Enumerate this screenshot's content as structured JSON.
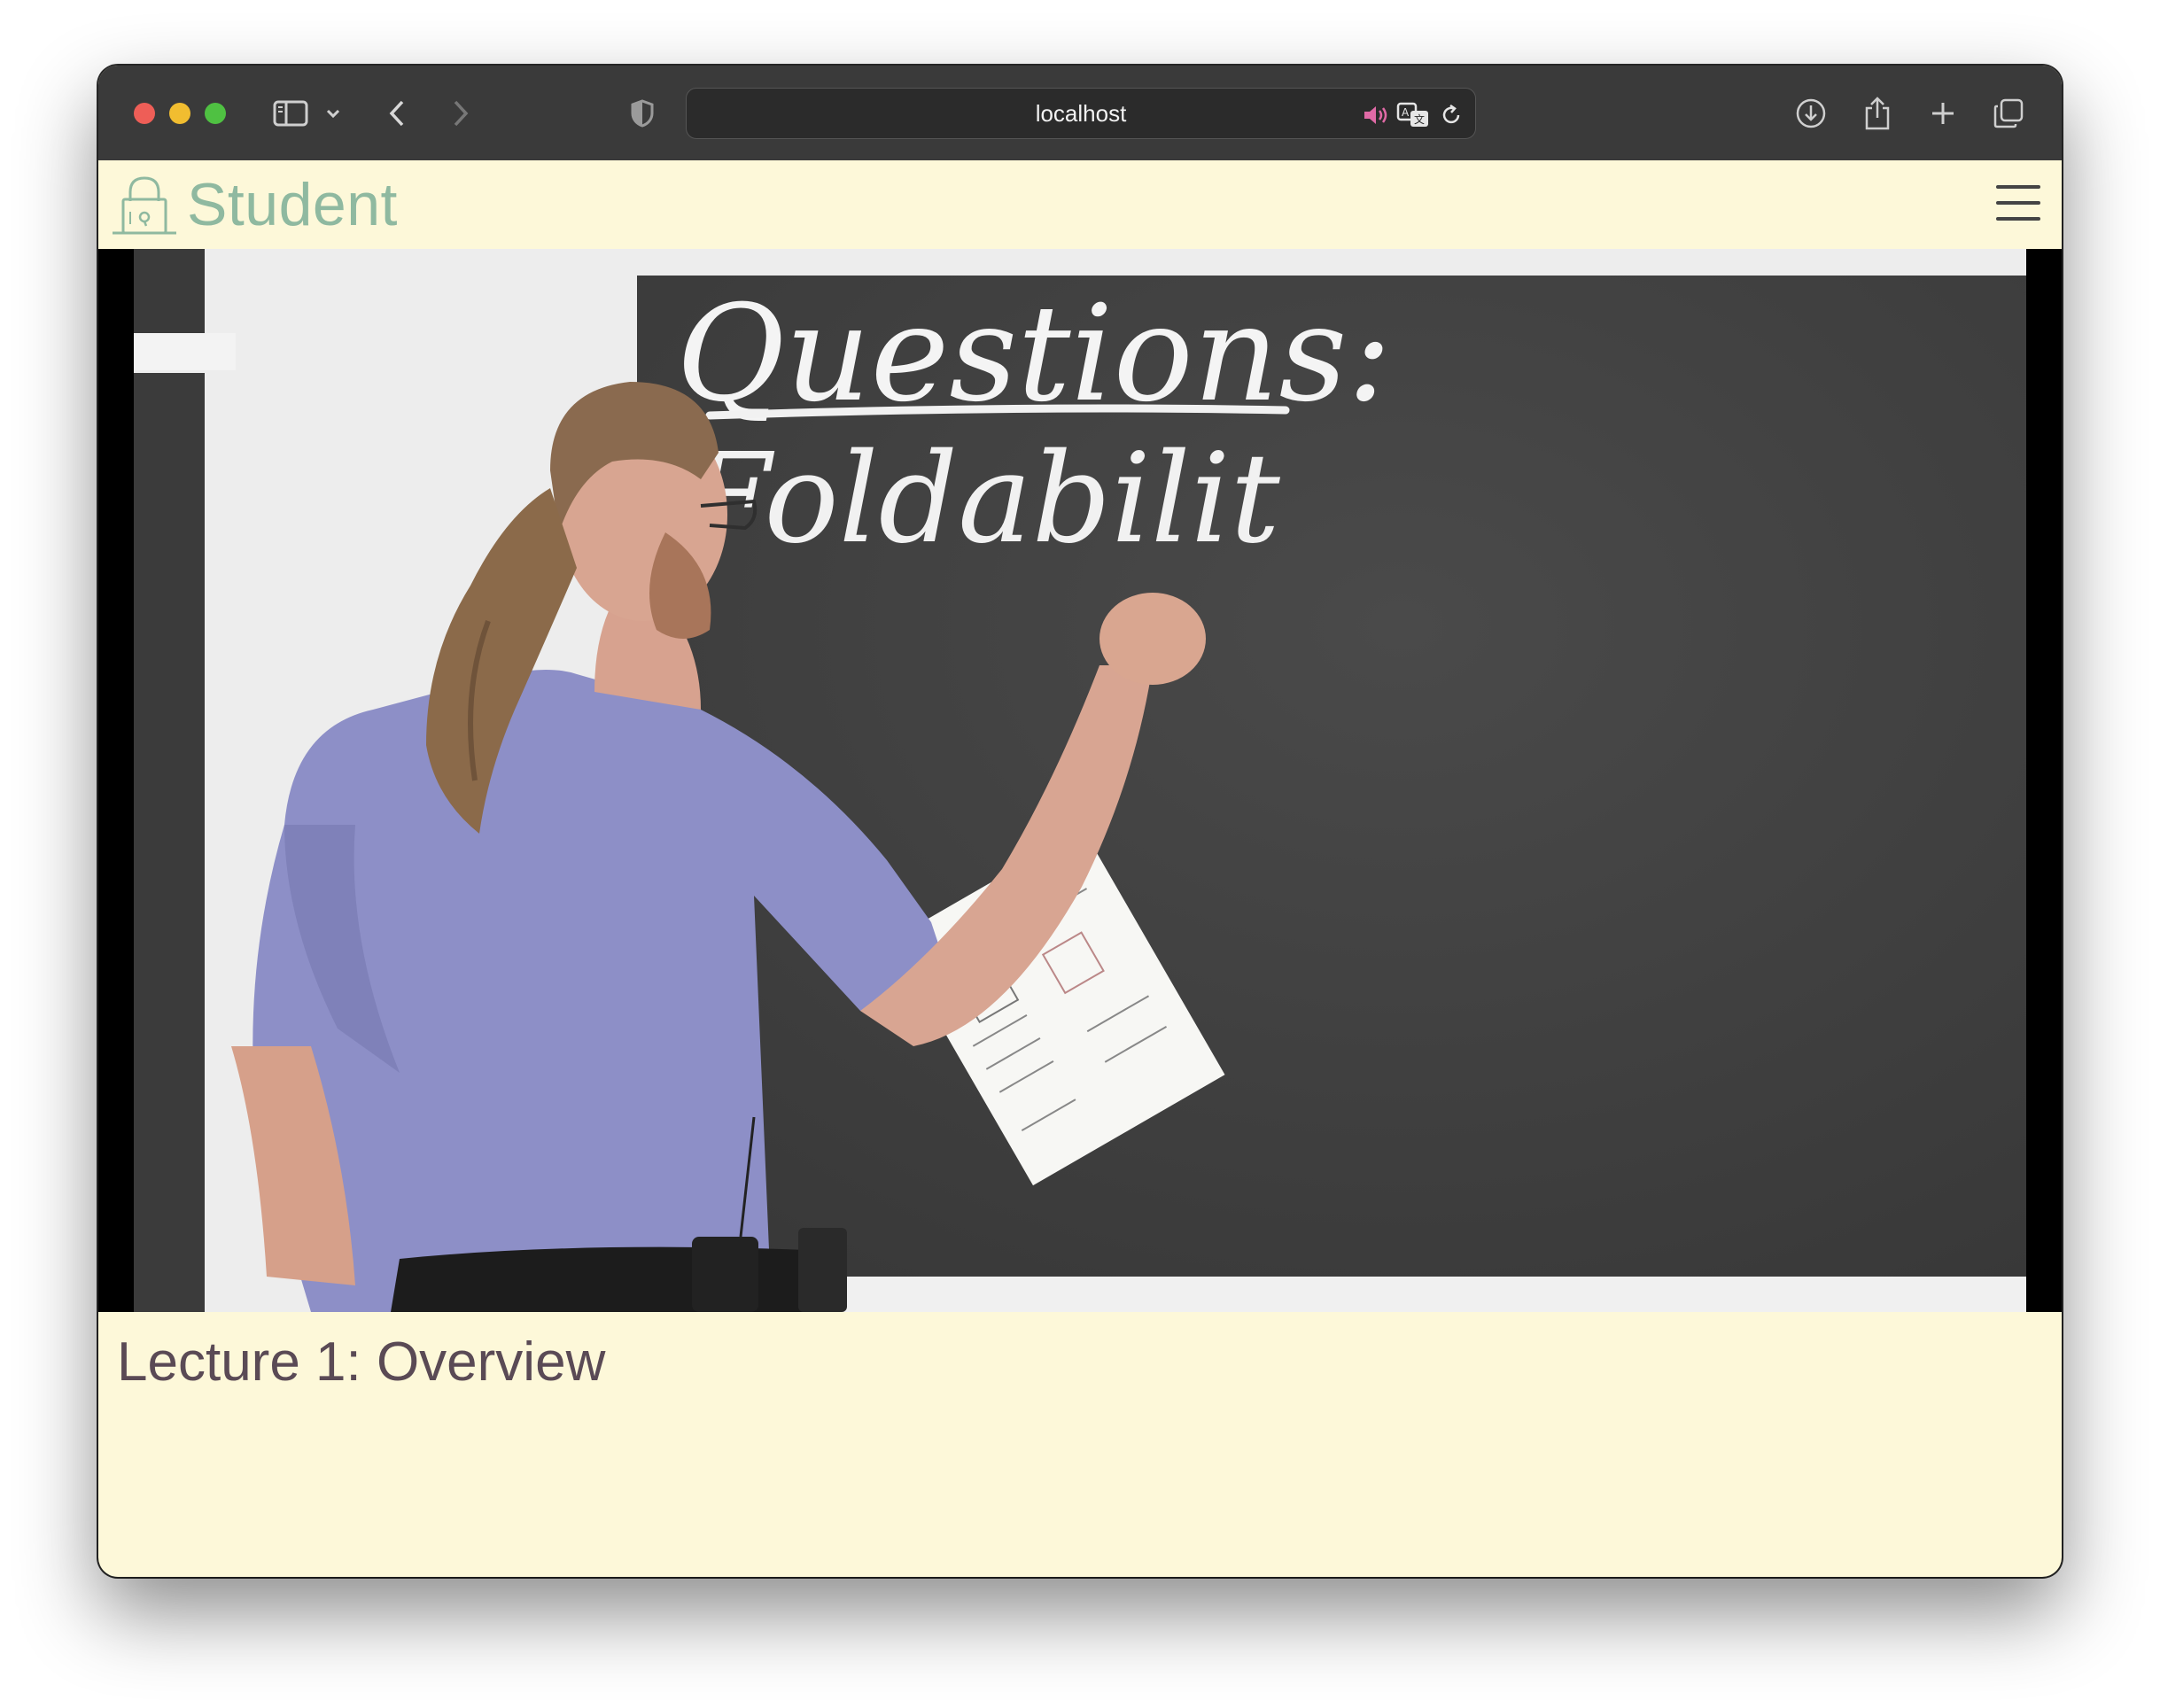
{
  "browser": {
    "url": "localhost",
    "icons": [
      "sidebar-icon",
      "chevron-down-icon",
      "back-icon",
      "forward-icon",
      "shield-icon",
      "speaker-icon",
      "translate-icon",
      "reload-icon",
      "download-icon",
      "share-icon",
      "plus-icon",
      "tabs-icon"
    ]
  },
  "app": {
    "brand": "Student",
    "brand_color": "#8fb9a0",
    "background": "#fdf8d9"
  },
  "video": {
    "board_text_1": "Questions:",
    "board_text_2": "Foldabilit"
  },
  "lecture": {
    "title": "Lecture 1: Overview"
  }
}
